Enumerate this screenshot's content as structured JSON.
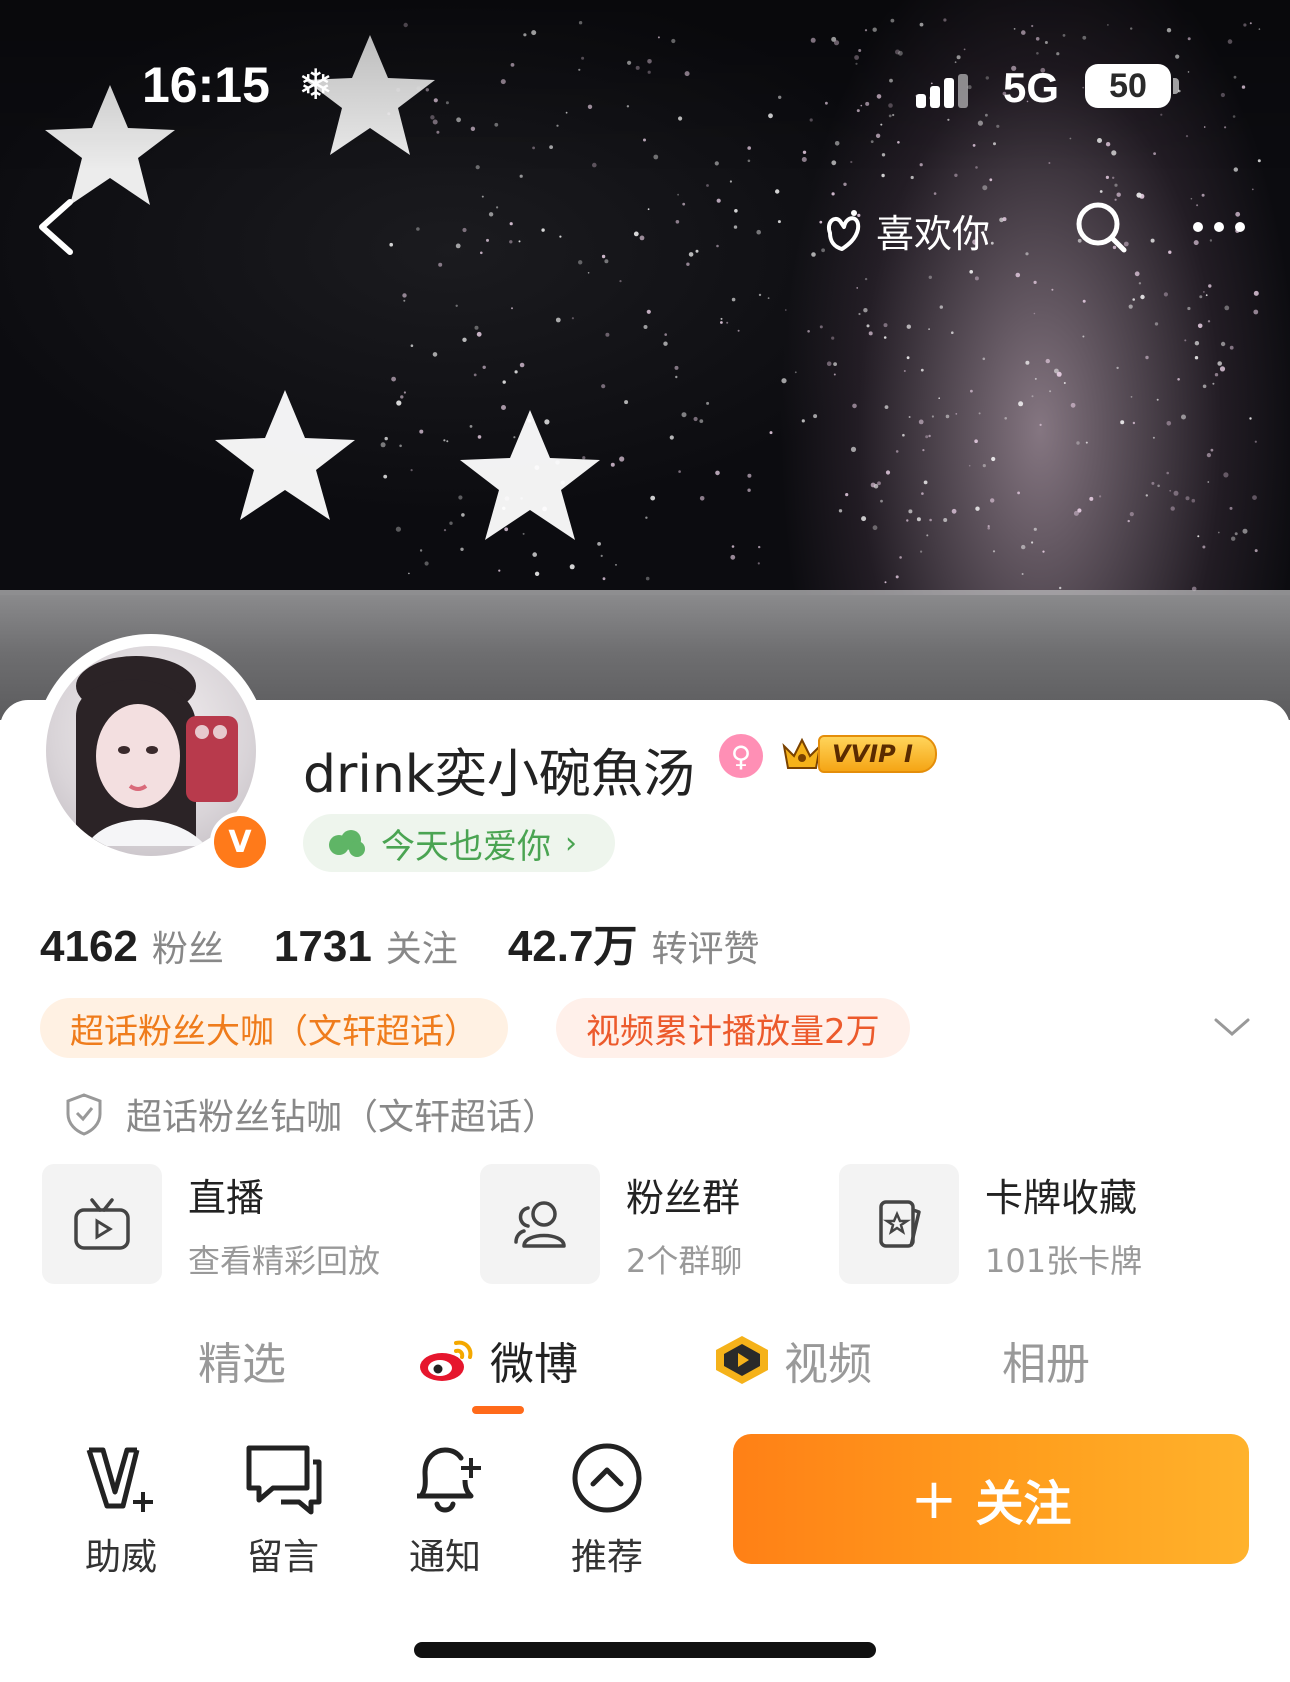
{
  "status_bar": {
    "time": "16:15",
    "network": "5G",
    "battery": "50"
  },
  "nav": {
    "like_label": "喜欢你"
  },
  "profile": {
    "username": "drink奕小碗魚汤",
    "vip_tag": "VVIP I",
    "verified_mark": "V",
    "mood": "今天也爱你"
  },
  "stats": [
    {
      "num": "4162",
      "label": "粉丝"
    },
    {
      "num": "1731",
      "label": "关注"
    },
    {
      "num": "42.7万",
      "label": "转评赞"
    }
  ],
  "badges": [
    "超话粉丝大咖（文轩超话）",
    "视频累计播放量2万"
  ],
  "honor": "超话粉丝钻咖（文轩超话）",
  "tiles": [
    {
      "title": "直播",
      "sub": "查看精彩回放",
      "icon": "tv-icon"
    },
    {
      "title": "粉丝群",
      "sub": "2个群聊",
      "icon": "group-icon"
    },
    {
      "title": "卡牌收藏",
      "sub": "101张卡牌",
      "icon": "card-icon"
    }
  ],
  "tabs": [
    "精选",
    "微博",
    "视频",
    "相册"
  ],
  "active_tab": "微博",
  "actions": [
    "助威",
    "留言",
    "通知",
    "推荐"
  ],
  "follow_label": "关注",
  "colors": {
    "accent": "#ff7a1a",
    "follow_start": "#ff8016",
    "follow_end": "#ffb22c",
    "mood_green": "#4aa452"
  }
}
